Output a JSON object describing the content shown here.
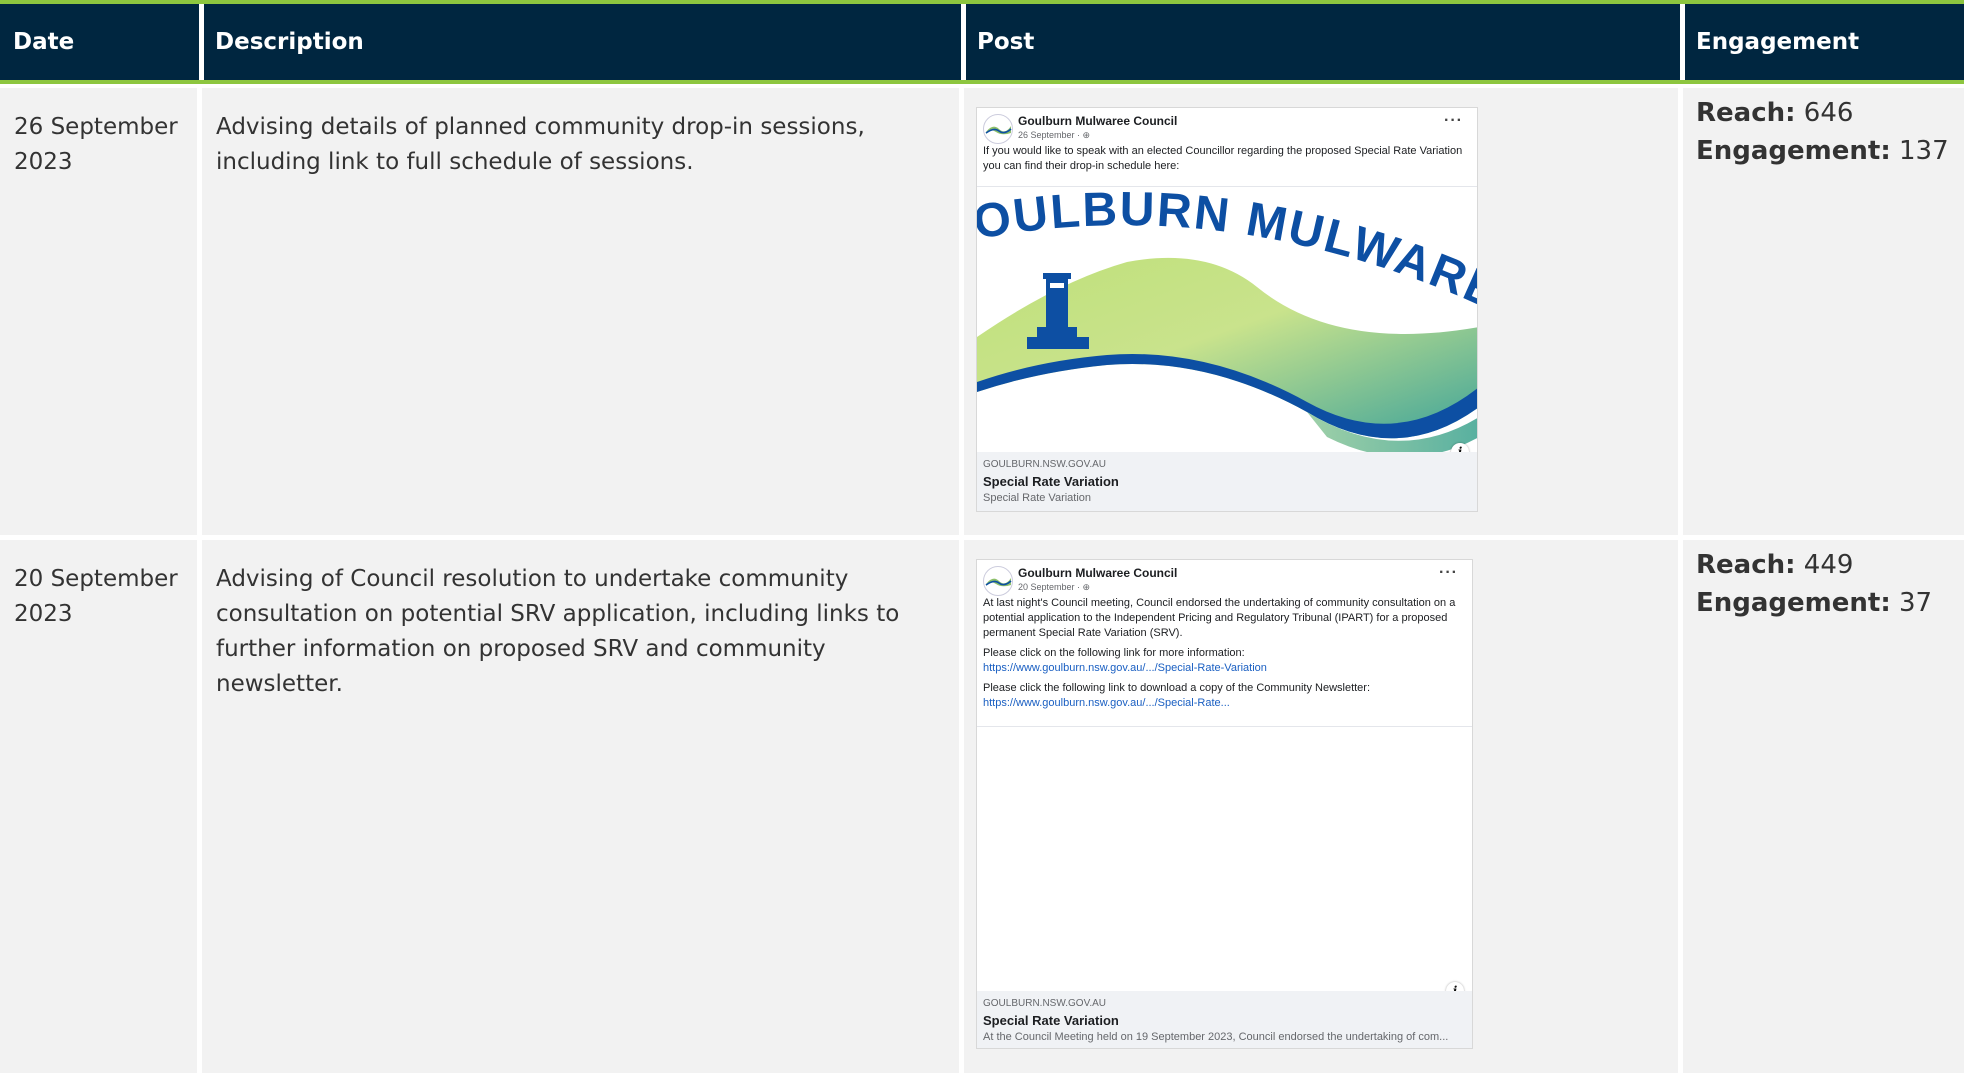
{
  "table": {
    "headers": {
      "date": "Date",
      "description": "Description",
      "post": "Post",
      "engagement": "Engagement"
    },
    "rows": [
      {
        "date": "26 September 2023",
        "description": "Advising details of planned community drop-in sessions, including link to full schedule of sessions.",
        "reach_label": "Reach:",
        "reach_value": "646",
        "engagement_label": "Engagement:",
        "engagement_value": "137",
        "post": {
          "page_name": "Goulburn Mulwaree Council",
          "post_date": "26 September · ",
          "globe_icon": "globe-icon",
          "more_label": "···",
          "paragraphs": [
            "If you would like to speak with an elected Councillor regarding the proposed Special Rate Variation you can find their drop-in schedule here:"
          ],
          "image_banner_text": "GOULBURN MULWAREE COUNCIL",
          "info_label": "i",
          "link_domain": "GOULBURN.NSW.GOV.AU",
          "link_title": "Special Rate Variation",
          "link_desc": "Special Rate Variation"
        }
      },
      {
        "date": "20 September 2023",
        "description": "Advising of Council resolution to undertake community consultation on potential SRV application, including links to further information on proposed SRV and community newsletter.",
        "reach_label": "Reach:",
        "reach_value": "449",
        "engagement_label": "Engagement:",
        "engagement_value": "37",
        "post": {
          "page_name": "Goulburn Mulwaree Council",
          "post_date": "20 September · ",
          "globe_icon": "globe-icon",
          "more_label": "···",
          "paragraph_1": "At last night's Council meeting, Council endorsed the undertaking of community consultation on a potential application to the Independent Pricing and Regulatory Tribunal (IPART) for a proposed permanent Special Rate Variation (SRV).",
          "paragraph_2": "Please click on the following link for more information:",
          "link_1": "https://www.goulburn.nsw.gov.au/.../Special-Rate-Variation",
          "paragraph_3": "Please click the following link to download a copy of the Community Newsletter:",
          "link_2": "https://www.goulburn.nsw.gov.au/.../Special-Rate...",
          "info_label": "i",
          "link_domain": "GOULBURN.NSW.GOV.AU",
          "link_title": "Special Rate Variation",
          "link_desc": "At the Council Meeting held on 19 September 2023, Council endorsed the undertaking of com..."
        }
      }
    ]
  },
  "colors": {
    "header_bg": "#002640",
    "accent_line": "#8dc63f",
    "cell_bg": "#f2f2f2",
    "logo_blue": "#0d4fa3"
  }
}
